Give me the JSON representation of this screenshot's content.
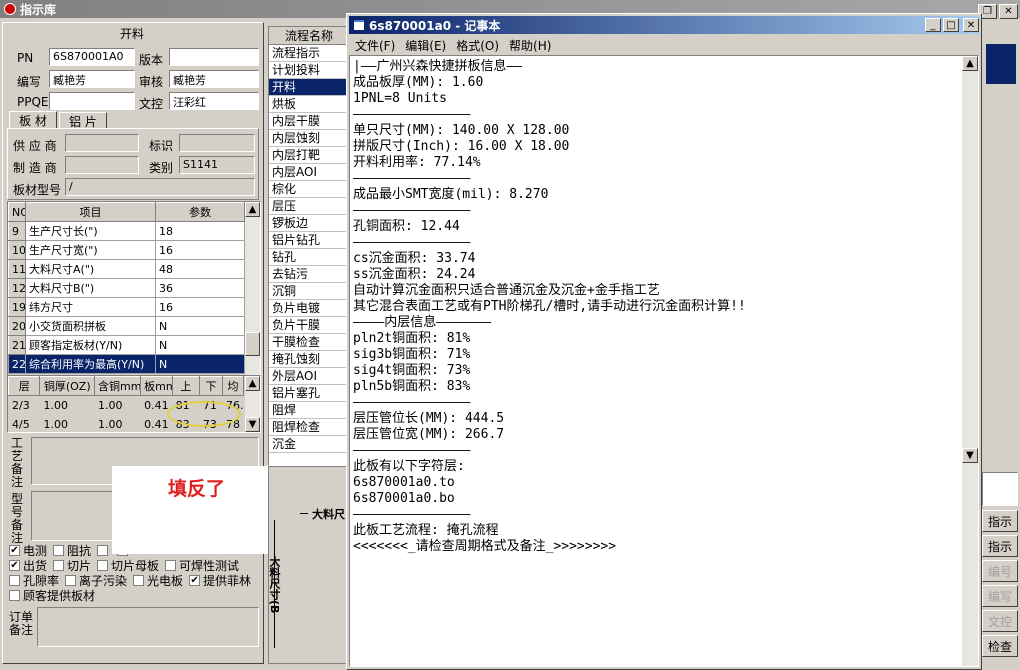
{
  "main": {
    "title": "指示库",
    "section_header": "开料",
    "fields": {
      "pn_label": "PN",
      "pn_value": "6S870001A0",
      "version_label": "版本",
      "version_value": "",
      "author_label": "编写",
      "author_value": "臧艳芳",
      "review_label": "审核",
      "review_value": "臧艳芳",
      "ppqe_label": "PPQE",
      "ppqe_value": "",
      "control_label": "文控",
      "control_value": "汪彩红"
    },
    "tabs": [
      "板 材",
      "铝 片"
    ],
    "supplier_label": "供 应 商",
    "supplier_value": "",
    "mark_label": "标识",
    "mark_value": "",
    "maker_label": "制 造 商",
    "maker_value": "",
    "category_label": "类别",
    "category_value": "S1141",
    "model_label": "板材型号",
    "model_value": "/",
    "param_table": {
      "headers": [
        "NO",
        "项目",
        "参数"
      ],
      "rows": [
        {
          "no": "9",
          "item": "生产尺寸长(\")",
          "val": "18"
        },
        {
          "no": "10",
          "item": "生产尺寸宽(\")",
          "val": "16"
        },
        {
          "no": "11",
          "item": "大料尺寸A(\")",
          "val": "48"
        },
        {
          "no": "12",
          "item": "大料尺寸B(\")",
          "val": "36"
        },
        {
          "no": "19",
          "item": "纬方尺寸",
          "val": "16"
        },
        {
          "no": "20",
          "item": "小交货面积拼板",
          "val": "N"
        },
        {
          "no": "21",
          "item": "顾客指定板材(Y/N)",
          "val": "N"
        },
        {
          "no": "22",
          "item": "综合利用率为最高(Y/N)",
          "val": "N"
        }
      ]
    },
    "layer_table": {
      "headers": [
        "层",
        "铜厚(OZ)",
        "含铜mm",
        "板mm",
        "上",
        "下",
        "均"
      ],
      "rows": [
        [
          "2/3",
          "1.00",
          "1.00",
          "0.41",
          "81",
          "71",
          "76."
        ],
        [
          "4/5",
          "1.00",
          "1.00",
          "0.41",
          "83",
          "73",
          "78"
        ]
      ]
    },
    "process_note_label": "工艺备注",
    "model_note_label": "型号备注",
    "order_note_label": "订单备注",
    "annotation": "填反了",
    "checkboxes": [
      [
        {
          "label": "电测",
          "checked": true
        },
        {
          "label": "阻抗",
          "checked": false
        },
        {
          "label": "",
          "checked": false
        },
        {
          "label": "",
          "checked": false
        }
      ],
      [
        {
          "label": "出货",
          "checked": true
        },
        {
          "label": "切片",
          "checked": false
        },
        {
          "label": "切片母板",
          "checked": false
        },
        {
          "label": "可焊性测试",
          "checked": false
        }
      ],
      [
        {
          "label": "孔隙率",
          "checked": false
        },
        {
          "label": "离子污染",
          "checked": false
        },
        {
          "label": "光电板",
          "checked": false
        },
        {
          "label": "提供菲林",
          "checked": true
        }
      ],
      [
        {
          "label": "顾客提供板材",
          "checked": false
        }
      ]
    ],
    "flow_header": "流程名称",
    "flow_items": [
      "流程指示",
      "计划投料",
      "开料",
      "烘板",
      "内层干膜",
      "内层蚀刻",
      "内层打靶",
      "内层AOI",
      "棕化",
      "层压",
      "锣板边",
      "铝片钻孔",
      "钻孔",
      "去钻污",
      "沉铜",
      "负片电镀",
      "负片干膜",
      "干膜检查",
      "掩孔蚀刻",
      "外层AOI",
      "铝片塞孔",
      "阻焊",
      "阻焊检查",
      "沉金"
    ],
    "flow_selected": 2,
    "lower_label": "大料尺",
    "vertical_label": "大料尺寸(B",
    "right_buttons": [
      "指示",
      "指示",
      "编号",
      "编写",
      "文控",
      "检查"
    ]
  },
  "notepad": {
    "title": "6s870001a0 - 记事本",
    "menu": [
      "文件(F)",
      "编辑(E)",
      "格式(O)",
      "帮助(H)"
    ],
    "lines": [
      "|——广州兴森快捷拼板信息——",
      "成品板厚(MM): 1.60",
      "1PNL=8 Units",
      "———————————————",
      "单只尺寸(MM): 140.00 X 128.00",
      "拼版尺寸(Inch): 16.00 X 18.00",
      "开料利用率: 77.14%",
      "———————————————",
      "成品最小SMT宽度(mil): 8.270",
      "———————————————",
      "孔铜面积: 12.44",
      "———————————————",
      "cs沉金面积: 33.74",
      "ss沉金面积: 24.24",
      "自动计算沉金面积只适合普通沉金及沉金+金手指工艺",
      "其它混合表面工艺或有PTH阶梯孔/槽时,请手动进行沉金面积计算!!",
      "————内层信息———————",
      "pln2t铜面积: 81%",
      "sig3b铜面积: 71%",
      "sig4t铜面积: 73%",
      "pln5b铜面积: 83%",
      "———————————————",
      "层压管位长(MM): 444.5",
      "层压管位宽(MM): 266.7",
      "———————————————",
      "此板有以下字符层:",
      "6s870001a0.to",
      "6s870001a0.bo",
      "———————————————",
      "此板工艺流程: 掩孔流程",
      "<<<<<<<_请检查周期格式及备注_>>>>>>>>"
    ]
  }
}
